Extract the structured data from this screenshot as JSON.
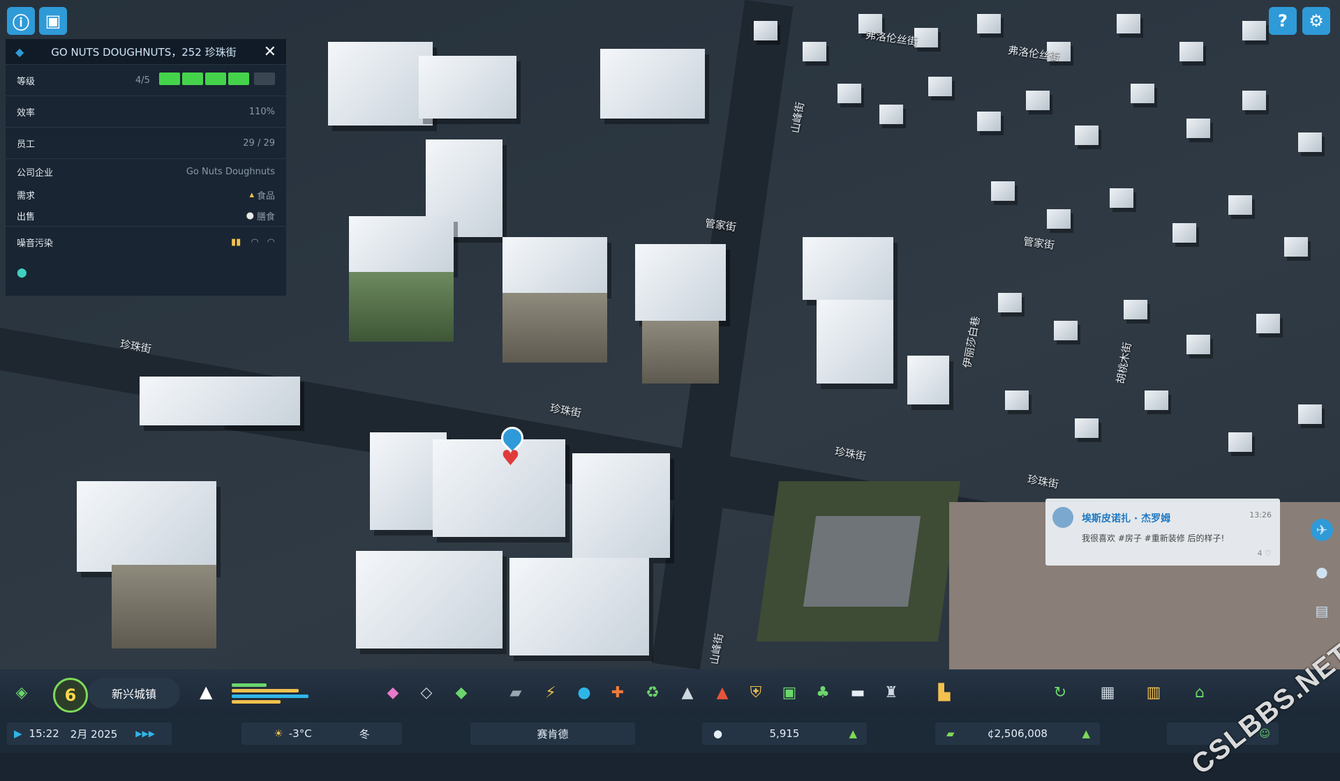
{
  "top_left": {
    "info_icon": "info-icon",
    "photo_icon": "photo-mode-icon"
  },
  "top_right": {
    "help_icon": "help-icon",
    "settings_icon": "gear-icon"
  },
  "info_panel": {
    "title": "GO NUTS DOUGHNUTS，252 珍珠街",
    "level": {
      "label": "等级",
      "value": "4/5",
      "fraction": 0.8
    },
    "efficiency": {
      "label": "效率",
      "value": "110%"
    },
    "employees": {
      "label": "员工",
      "value": "29 / 29"
    },
    "company": {
      "label": "公司企业",
      "value": "Go Nuts Doughnuts"
    },
    "demand": {
      "label": "需求",
      "value": "食品"
    },
    "sells": {
      "label": "出售",
      "value": "膳食"
    },
    "noise": {
      "label": "噪音污染"
    }
  },
  "street_labels": [
    "弗洛伦丝街",
    "弗洛伦丝街",
    "珍珠街",
    "珍珠街",
    "珍珠街",
    "珍珠街",
    "管家街",
    "伊丽莎白巷",
    "胡桃木街",
    "山峰街",
    "山峰街",
    "管家街"
  ],
  "chirp": {
    "author": "埃斯皮诺扎 · 杰罗姆",
    "time": "13:26",
    "message": "我很喜欢 #房子 #重新装修 后的样子!",
    "likes": "4"
  },
  "toolbar": {
    "milestone": "6",
    "city_name": "新兴城镇"
  },
  "status_bar": {
    "time": "15:22",
    "date": "2月 2025",
    "temperature": "-3°C",
    "season": "冬",
    "mayor": "赛肯德",
    "population": "5,915",
    "money": "¢2,506,008"
  },
  "watermark": "CSLBBS.NET",
  "colors": {
    "accent": "#2f9ad8",
    "level_bar": "#46d34c",
    "chirp_author": "#1e78c2",
    "trend_up": "#7ed957"
  }
}
